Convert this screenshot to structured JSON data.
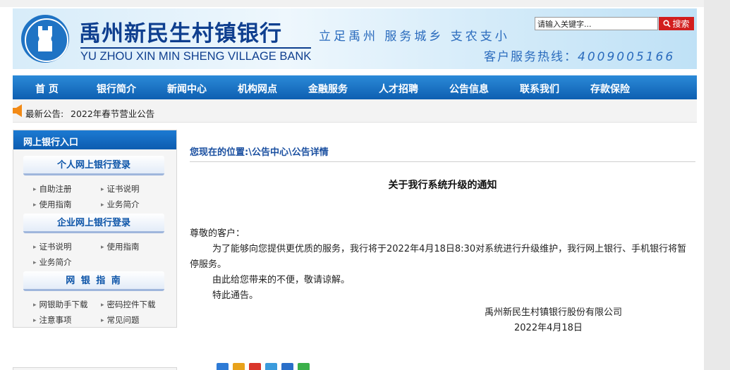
{
  "header": {
    "bank_name_cn": "禹州新民生村镇银行",
    "bank_name_en": "YU ZHOU XIN MIN SHENG VILLAGE BANK",
    "slogan": "立足禹州 服务城乡 支农支小",
    "hotline_label": "客户服务热线：",
    "hotline_number": "4009005166",
    "search": {
      "placeholder": "请输入关键字...",
      "value": "请输入关键字...",
      "button_label": "搜索"
    }
  },
  "nav": {
    "items": [
      "首 页",
      "银行简介",
      "新闻中心",
      "机构网点",
      "金融服务",
      "人才招聘",
      "公告信息",
      "联系我们",
      "存款保险"
    ]
  },
  "notice": {
    "label": "最新公告:",
    "title": "2022年春节营业公告"
  },
  "sidebar": {
    "heading": "网上银行入口",
    "groups": [
      {
        "title": "个人网上银行登录",
        "links": [
          "自助注册",
          "证书说明",
          "使用指南",
          "业务简介"
        ]
      },
      {
        "title": "企业网上银行登录",
        "links": [
          "证书说明",
          "使用指南",
          "业务简介"
        ]
      },
      {
        "title": "网  银  指  南",
        "links": [
          "网银助手下载",
          "密码控件下载",
          "注意事项",
          "常见问题"
        ]
      }
    ]
  },
  "breadcrumb": {
    "prefix": "您现在的位置:",
    "sep1": "\\",
    "item1": "公告中心",
    "sep2": "\\",
    "item2": "公告详情"
  },
  "article": {
    "title": "关于我行系统升级的通知",
    "greeting": "尊敬的客户：",
    "para1": "为了能够向您提供更优质的服务，我行将于2022年4月18日8:30对系统进行升级维护，我行网上银行、手机银行将暂停服务。",
    "para2": "由此给您带来的不便，敬请谅解。",
    "para3": "特此通告。",
    "signature": "禹州新民生村镇银行股份有限公司",
    "date": "2022年4月18日"
  },
  "colors": {
    "brand_blue": "#0f3f8f",
    "nav_blue": "#1672c8",
    "search_red": "#d21f1f",
    "link_blue": "#1a4fa0"
  },
  "icons": [
    "bank-logo-icon",
    "search-icon",
    "speaker-icon",
    "share-icons"
  ]
}
